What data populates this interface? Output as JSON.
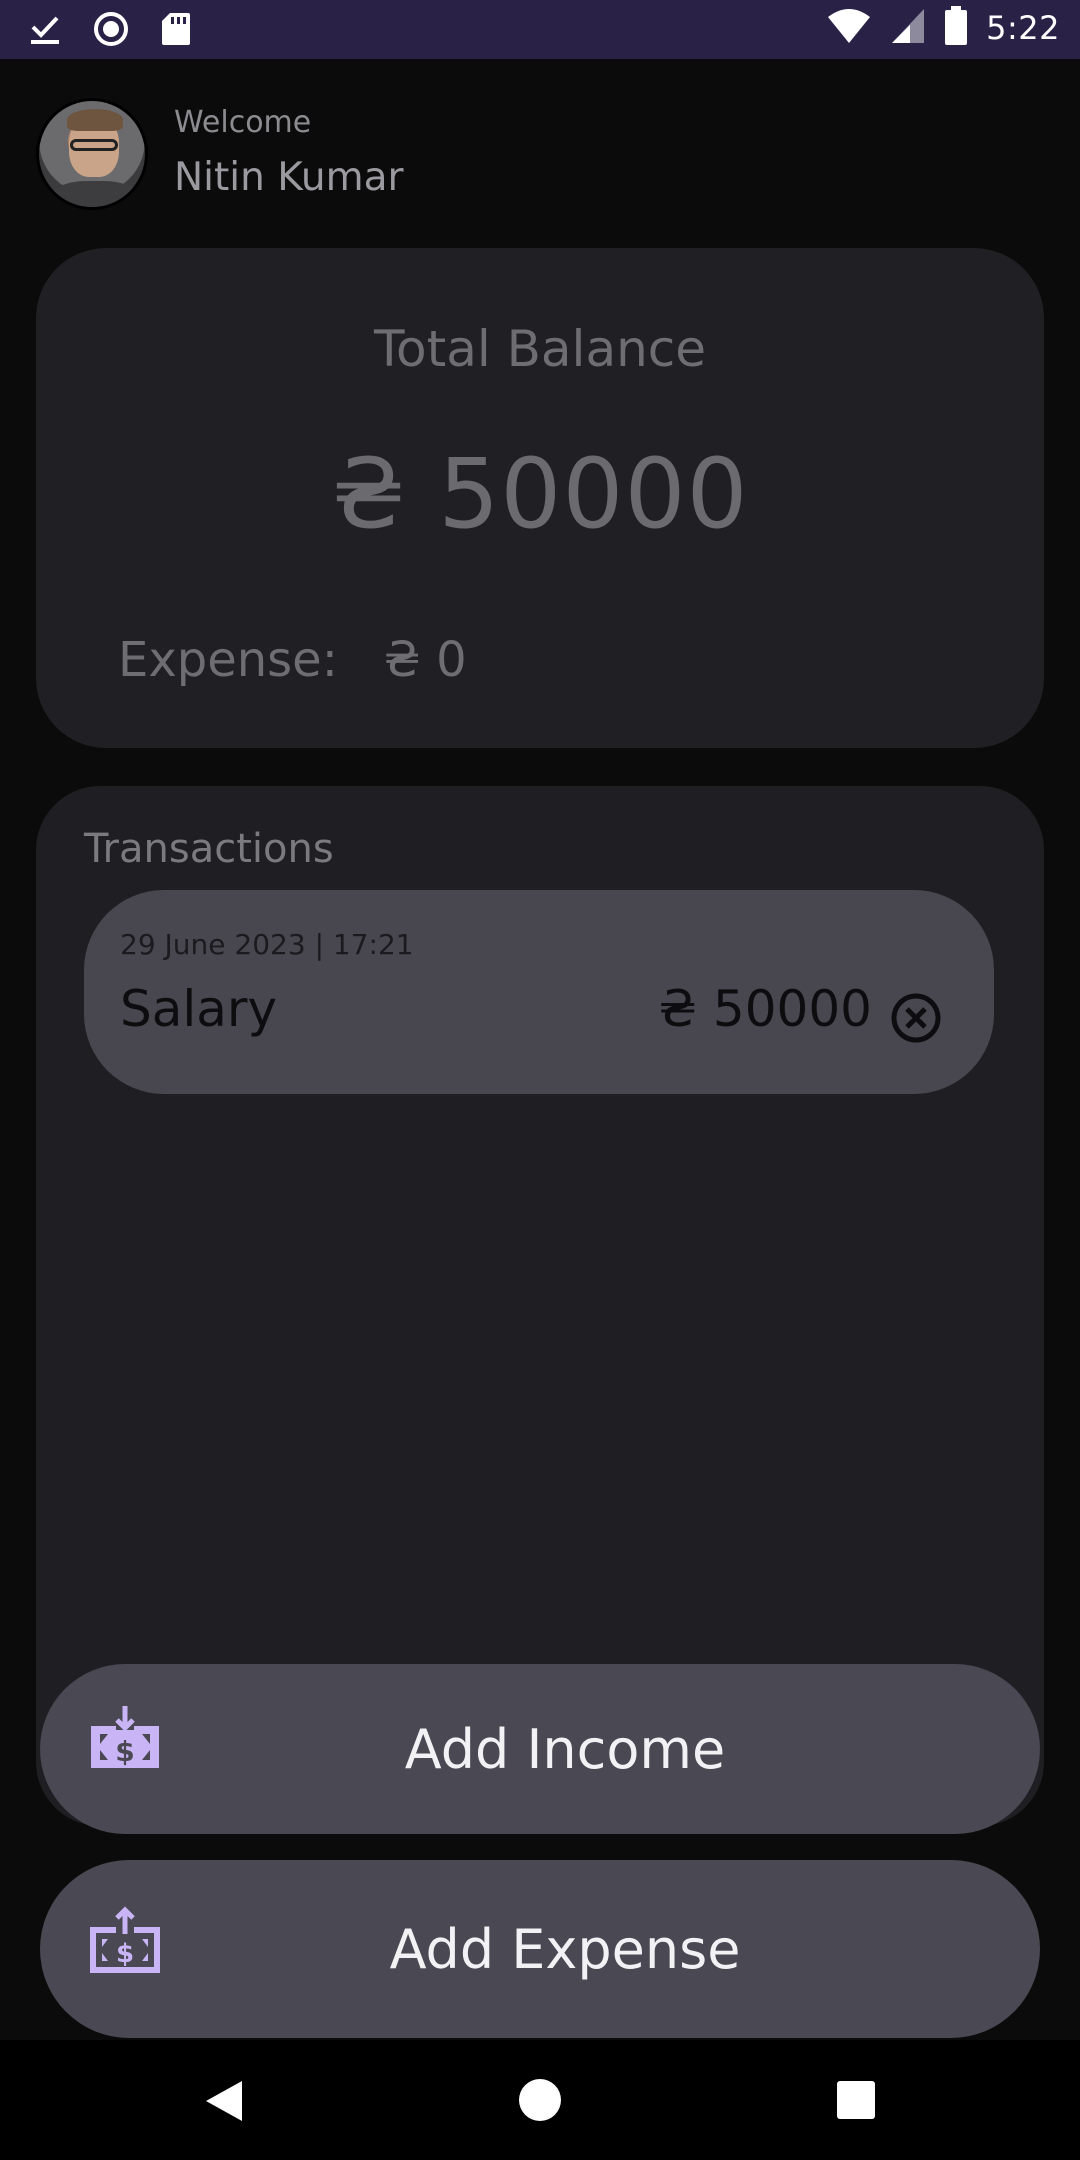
{
  "status_bar": {
    "time": "5:22",
    "left_icons": [
      "check-download-icon",
      "record-icon",
      "sd-card-icon"
    ],
    "right_icons": [
      "wifi-icon",
      "cell-signal-icon",
      "battery-icon"
    ]
  },
  "header": {
    "welcome": "Welcome",
    "user_name": "Nitin Kumar"
  },
  "balance_card": {
    "title": "Total Balance",
    "amount": "₴ 50000",
    "expense_label": "Expense:",
    "expense_amount": "₴ 0"
  },
  "transactions": {
    "title": "Transactions",
    "items": [
      {
        "date": "29 June 2023 | 17:21",
        "name": "Salary",
        "amount": "₴ 50000"
      }
    ]
  },
  "actions": {
    "add_income": "Add Income",
    "add_expense": "Add Expense"
  },
  "colors": {
    "status_bar": "#2a2246",
    "background": "#0b0b0c",
    "card": "#202024",
    "button": "#4a4852",
    "accent_icon": "#c9b4f5"
  }
}
